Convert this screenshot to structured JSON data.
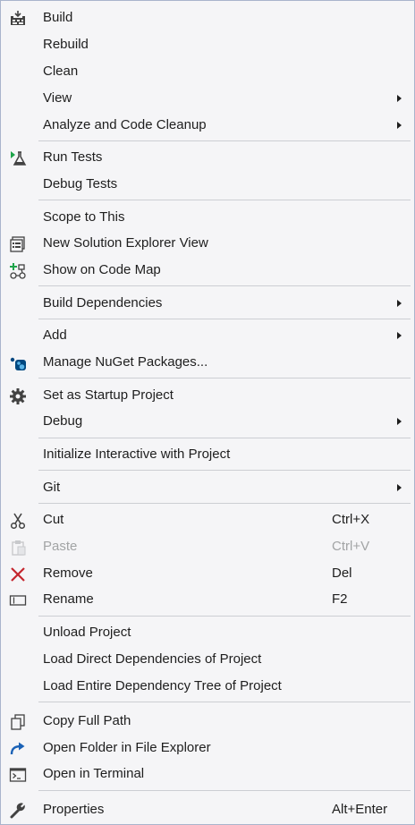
{
  "menu": {
    "build": {
      "label": "Build"
    },
    "rebuild": {
      "label": "Rebuild"
    },
    "clean": {
      "label": "Clean"
    },
    "view": {
      "label": "View"
    },
    "analyze": {
      "label": "Analyze and Code Cleanup"
    },
    "run_tests": {
      "label": "Run Tests"
    },
    "debug_tests": {
      "label": "Debug Tests"
    },
    "scope": {
      "label": "Scope to This"
    },
    "new_se_view": {
      "label": "New Solution Explorer View"
    },
    "code_map": {
      "label": "Show on Code Map"
    },
    "build_deps": {
      "label": "Build Dependencies"
    },
    "add": {
      "label": "Add"
    },
    "nuget": {
      "label": "Manage NuGet Packages..."
    },
    "startup": {
      "label": "Set as Startup Project"
    },
    "debug": {
      "label": "Debug"
    },
    "interactive": {
      "label": "Initialize Interactive with Project"
    },
    "git": {
      "label": "Git"
    },
    "cut": {
      "label": "Cut",
      "shortcut": "Ctrl+X"
    },
    "paste": {
      "label": "Paste",
      "shortcut": "Ctrl+V"
    },
    "remove": {
      "label": "Remove",
      "shortcut": "Del"
    },
    "rename": {
      "label": "Rename",
      "shortcut": "F2"
    },
    "unload": {
      "label": "Unload Project"
    },
    "load_direct": {
      "label": "Load Direct Dependencies of Project"
    },
    "load_tree": {
      "label": "Load Entire Dependency Tree of Project"
    },
    "copy_path": {
      "label": "Copy Full Path"
    },
    "open_folder": {
      "label": "Open Folder in File Explorer"
    },
    "terminal": {
      "label": "Open in Terminal"
    },
    "properties": {
      "label": "Properties",
      "shortcut": "Alt+Enter"
    }
  },
  "colors": {
    "background": "#f5f5f7",
    "border": "#a9b4cc",
    "text": "#1e1e1e",
    "disabled_text": "#a2a4a5",
    "remove_icon": "#c4262e",
    "open_folder_icon": "#1b62b6",
    "run_tests_icon": "#1ea44a"
  },
  "icons": {
    "build": "build-icon",
    "run_tests": "flask-icon",
    "new_se_view": "solution-explorer-view-icon",
    "code_map": "code-map-icon",
    "nuget": "nuget-icon",
    "startup": "gear-icon",
    "cut": "scissors-icon",
    "paste": "clipboard-icon",
    "remove": "close-icon",
    "rename": "rename-icon",
    "copy_path": "copy-icon",
    "open_folder": "redo-arrow-icon",
    "terminal": "terminal-icon",
    "properties": "wrench-icon"
  }
}
